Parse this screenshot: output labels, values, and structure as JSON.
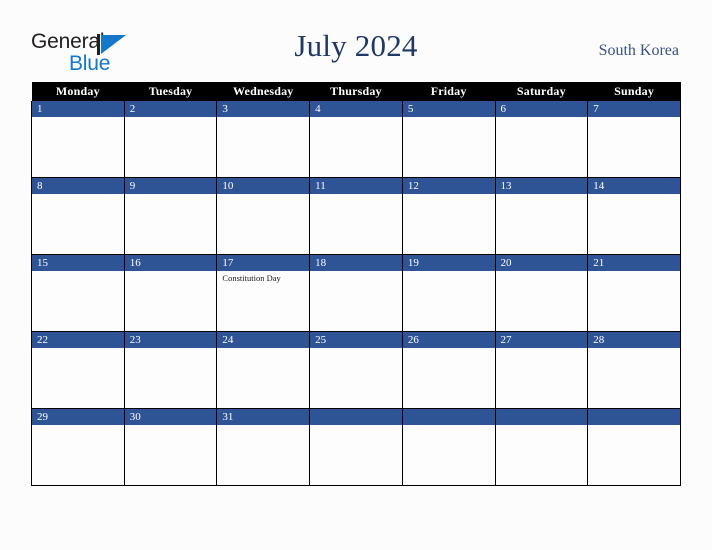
{
  "logo": {
    "line1": "General",
    "line2": "Blue",
    "triangle_icon": "triangle-icon",
    "color_dark": "#231f20",
    "color_blue": "#1477c9"
  },
  "header": {
    "title": "July 2024",
    "region": "South Korea",
    "title_color": "#1f3864",
    "region_color": "#3b5182"
  },
  "calendar": {
    "accent_color": "#2f5496",
    "header_bg": "#000000",
    "weekday_headers": [
      "Monday",
      "Tuesday",
      "Wednesday",
      "Thursday",
      "Friday",
      "Saturday",
      "Sunday"
    ],
    "weeks": [
      [
        {
          "day": "1",
          "events": []
        },
        {
          "day": "2",
          "events": []
        },
        {
          "day": "3",
          "events": []
        },
        {
          "day": "4",
          "events": []
        },
        {
          "day": "5",
          "events": []
        },
        {
          "day": "6",
          "events": []
        },
        {
          "day": "7",
          "events": []
        }
      ],
      [
        {
          "day": "8",
          "events": []
        },
        {
          "day": "9",
          "events": []
        },
        {
          "day": "10",
          "events": []
        },
        {
          "day": "11",
          "events": []
        },
        {
          "day": "12",
          "events": []
        },
        {
          "day": "13",
          "events": []
        },
        {
          "day": "14",
          "events": []
        }
      ],
      [
        {
          "day": "15",
          "events": []
        },
        {
          "day": "16",
          "events": []
        },
        {
          "day": "17",
          "events": [
            "Constitution Day"
          ]
        },
        {
          "day": "18",
          "events": []
        },
        {
          "day": "19",
          "events": []
        },
        {
          "day": "20",
          "events": []
        },
        {
          "day": "21",
          "events": []
        }
      ],
      [
        {
          "day": "22",
          "events": []
        },
        {
          "day": "23",
          "events": []
        },
        {
          "day": "24",
          "events": []
        },
        {
          "day": "25",
          "events": []
        },
        {
          "day": "26",
          "events": []
        },
        {
          "day": "27",
          "events": []
        },
        {
          "day": "28",
          "events": []
        }
      ],
      [
        {
          "day": "29",
          "events": []
        },
        {
          "day": "30",
          "events": []
        },
        {
          "day": "31",
          "events": []
        },
        {
          "day": "",
          "events": []
        },
        {
          "day": "",
          "events": []
        },
        {
          "day": "",
          "events": []
        },
        {
          "day": "",
          "events": []
        }
      ]
    ]
  }
}
